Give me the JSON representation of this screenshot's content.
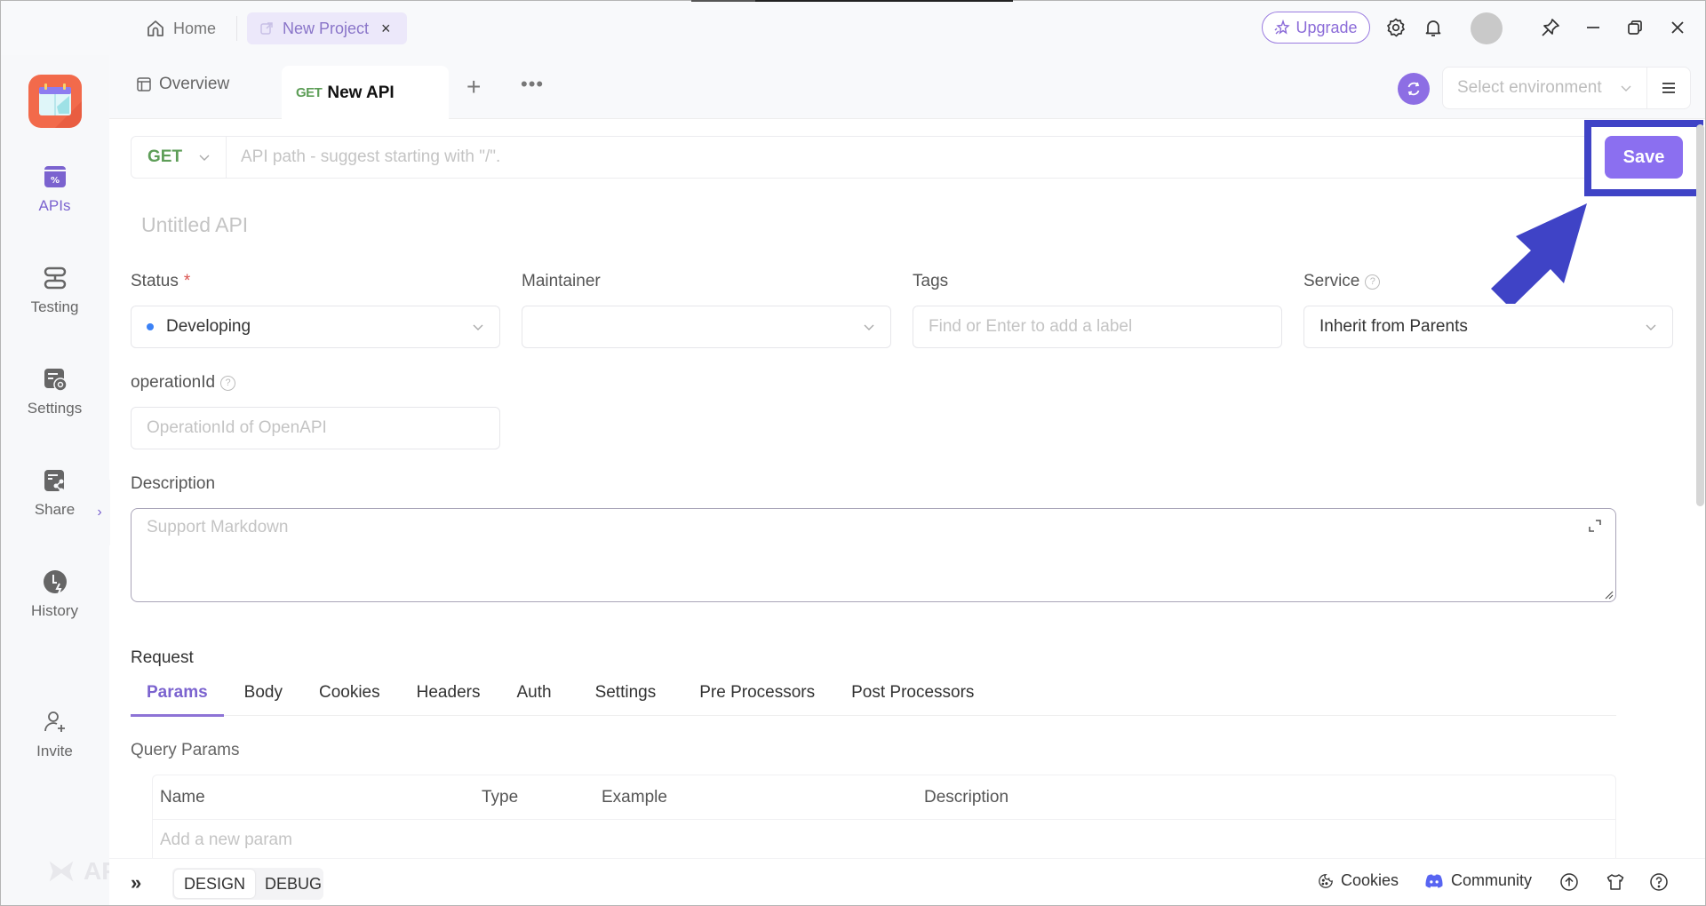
{
  "titlebar": {
    "home_label": "Home",
    "project_tab_label": "New Project",
    "project_tab_close": "×",
    "upgrade_label": "Upgrade"
  },
  "sidebar": {
    "items": [
      {
        "label": "APIs",
        "icon": "api-icon",
        "active": true
      },
      {
        "label": "Testing",
        "icon": "testing-icon"
      },
      {
        "label": "Settings",
        "icon": "settings-icon"
      },
      {
        "label": "Share",
        "icon": "share-icon"
      },
      {
        "label": "History",
        "icon": "history-icon"
      },
      {
        "label": "Invite",
        "icon": "invite-icon"
      }
    ],
    "watermark": "AP"
  },
  "tabs": {
    "overview_label": "Overview",
    "active_tab_method": "GET",
    "active_tab_name": "New API",
    "add_label": "+",
    "more_label": "•••"
  },
  "environment": {
    "placeholder": "Select environment"
  },
  "request_line": {
    "method": "GET",
    "path_placeholder": "API path - suggest starting with \"/\".",
    "save_label": "Save"
  },
  "api": {
    "title_placeholder": "Untitled API"
  },
  "fields": {
    "status_label": "Status",
    "status_required": "*",
    "status_value": "Developing",
    "status_color": "#3c82f6",
    "maintainer_label": "Maintainer",
    "maintainer_value": "",
    "tags_label": "Tags",
    "tags_placeholder": "Find or Enter to add a label",
    "service_label": "Service",
    "service_value": "Inherit from Parents",
    "operation_label": "operationId",
    "operation_placeholder": "OperationId of OpenAPI",
    "description_label": "Description",
    "description_placeholder": "Support Markdown"
  },
  "request": {
    "section_title": "Request",
    "tabs": [
      "Params",
      "Body",
      "Cookies",
      "Headers",
      "Auth",
      "Settings",
      "Pre Processors",
      "Post Processors"
    ],
    "active_tab": "Params",
    "query_title": "Query Params",
    "columns": [
      "Name",
      "Type",
      "Example",
      "Description"
    ],
    "add_placeholder": "Add a new param"
  },
  "bottombar": {
    "expand_label": "»",
    "modes": [
      "DESIGN",
      "DEBUG"
    ],
    "active_mode": "DESIGN",
    "cookies_label": "Cookies",
    "community_label": "Community"
  },
  "colors": {
    "accent": "#8b6ff0",
    "highlight": "#3f43c6",
    "get_method": "#5e9e58"
  }
}
